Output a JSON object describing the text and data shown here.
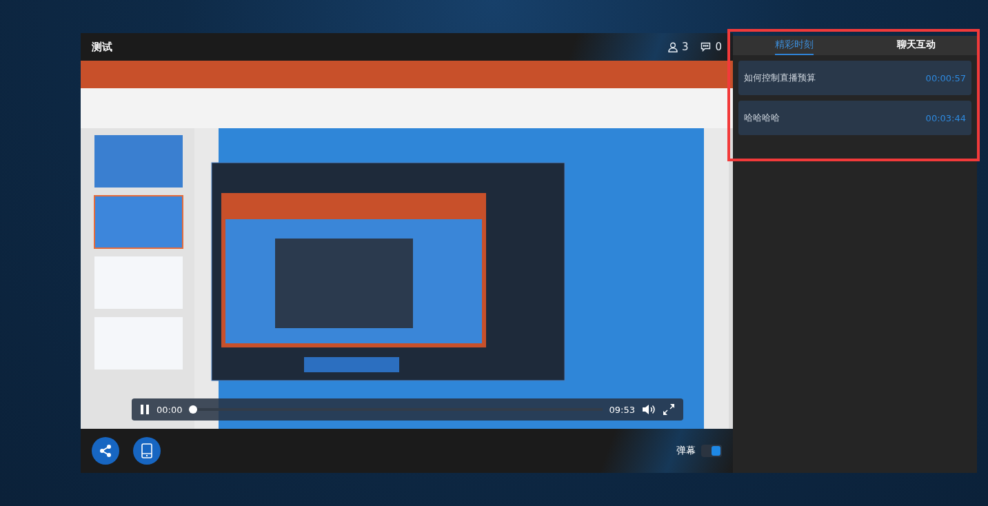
{
  "player": {
    "title": "测试",
    "viewers": "3",
    "comments": "0",
    "controls": {
      "playing": true,
      "current": "00:00",
      "duration": "09:53",
      "level": 0.0
    },
    "danmaku": {
      "label": "弹幕",
      "on": true
    }
  },
  "panel": {
    "tabs": [
      {
        "label": "精彩时刻",
        "selected": true
      },
      {
        "label": "聊天互动",
        "selected": false
      }
    ],
    "moments": [
      {
        "title": "如何控制直播预算",
        "time": "00:00:57"
      },
      {
        "title": "哈哈哈哈",
        "time": "00:03:44"
      }
    ]
  }
}
